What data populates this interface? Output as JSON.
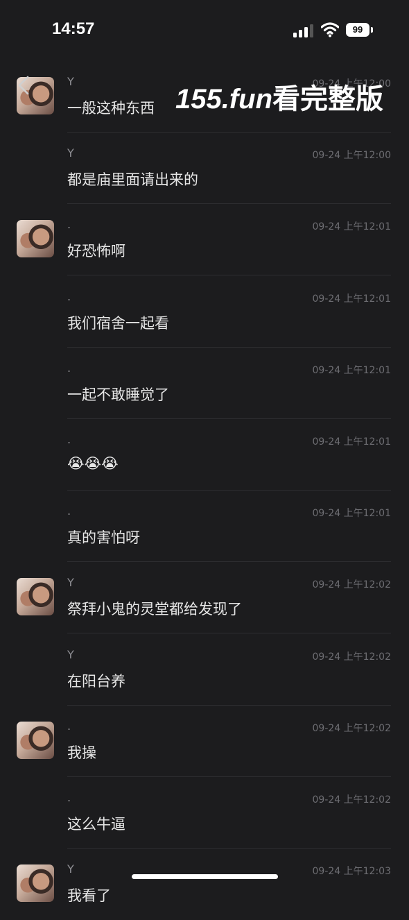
{
  "status_bar": {
    "time": "14:57",
    "battery": "99"
  },
  "watermark": {
    "part1": "155.fun",
    "part2": "看完整版"
  },
  "messages": [
    {
      "sender": "Y",
      "time": "09-24 上午12:00",
      "text": "一般这种东西",
      "avatar": true
    },
    {
      "sender": "Y",
      "time": "09-24 上午12:00",
      "text": "都是庙里面请出来的",
      "avatar": false
    },
    {
      "sender": ".",
      "time": "09-24 上午12:01",
      "text": "好恐怖啊",
      "avatar": true
    },
    {
      "sender": ".",
      "time": "09-24 上午12:01",
      "text": "我们宿舍一起看",
      "avatar": false
    },
    {
      "sender": ".",
      "time": "09-24 上午12:01",
      "text": "一起不敢睡觉了",
      "avatar": false
    },
    {
      "sender": ".",
      "time": "09-24 上午12:01",
      "text": "😭😭😭",
      "avatar": false
    },
    {
      "sender": ".",
      "time": "09-24 上午12:01",
      "text": "真的害怕呀",
      "avatar": false
    },
    {
      "sender": "Y",
      "time": "09-24 上午12:02",
      "text": "祭拜小鬼的灵堂都给发现了",
      "avatar": true
    },
    {
      "sender": "Y",
      "time": "09-24 上午12:02",
      "text": "在阳台养",
      "avatar": false
    },
    {
      "sender": ".",
      "time": "09-24 上午12:02",
      "text": "我操",
      "avatar": true
    },
    {
      "sender": ".",
      "time": "09-24 上午12:02",
      "text": "这么牛逼",
      "avatar": false
    },
    {
      "sender": "Y",
      "time": "09-24 上午12:03",
      "text": "我看了",
      "avatar": true
    }
  ],
  "icons": {
    "back": "chevron-left-icon",
    "signal": "cellular-signal-icon",
    "wifi": "wifi-icon",
    "battery": "battery-icon"
  }
}
